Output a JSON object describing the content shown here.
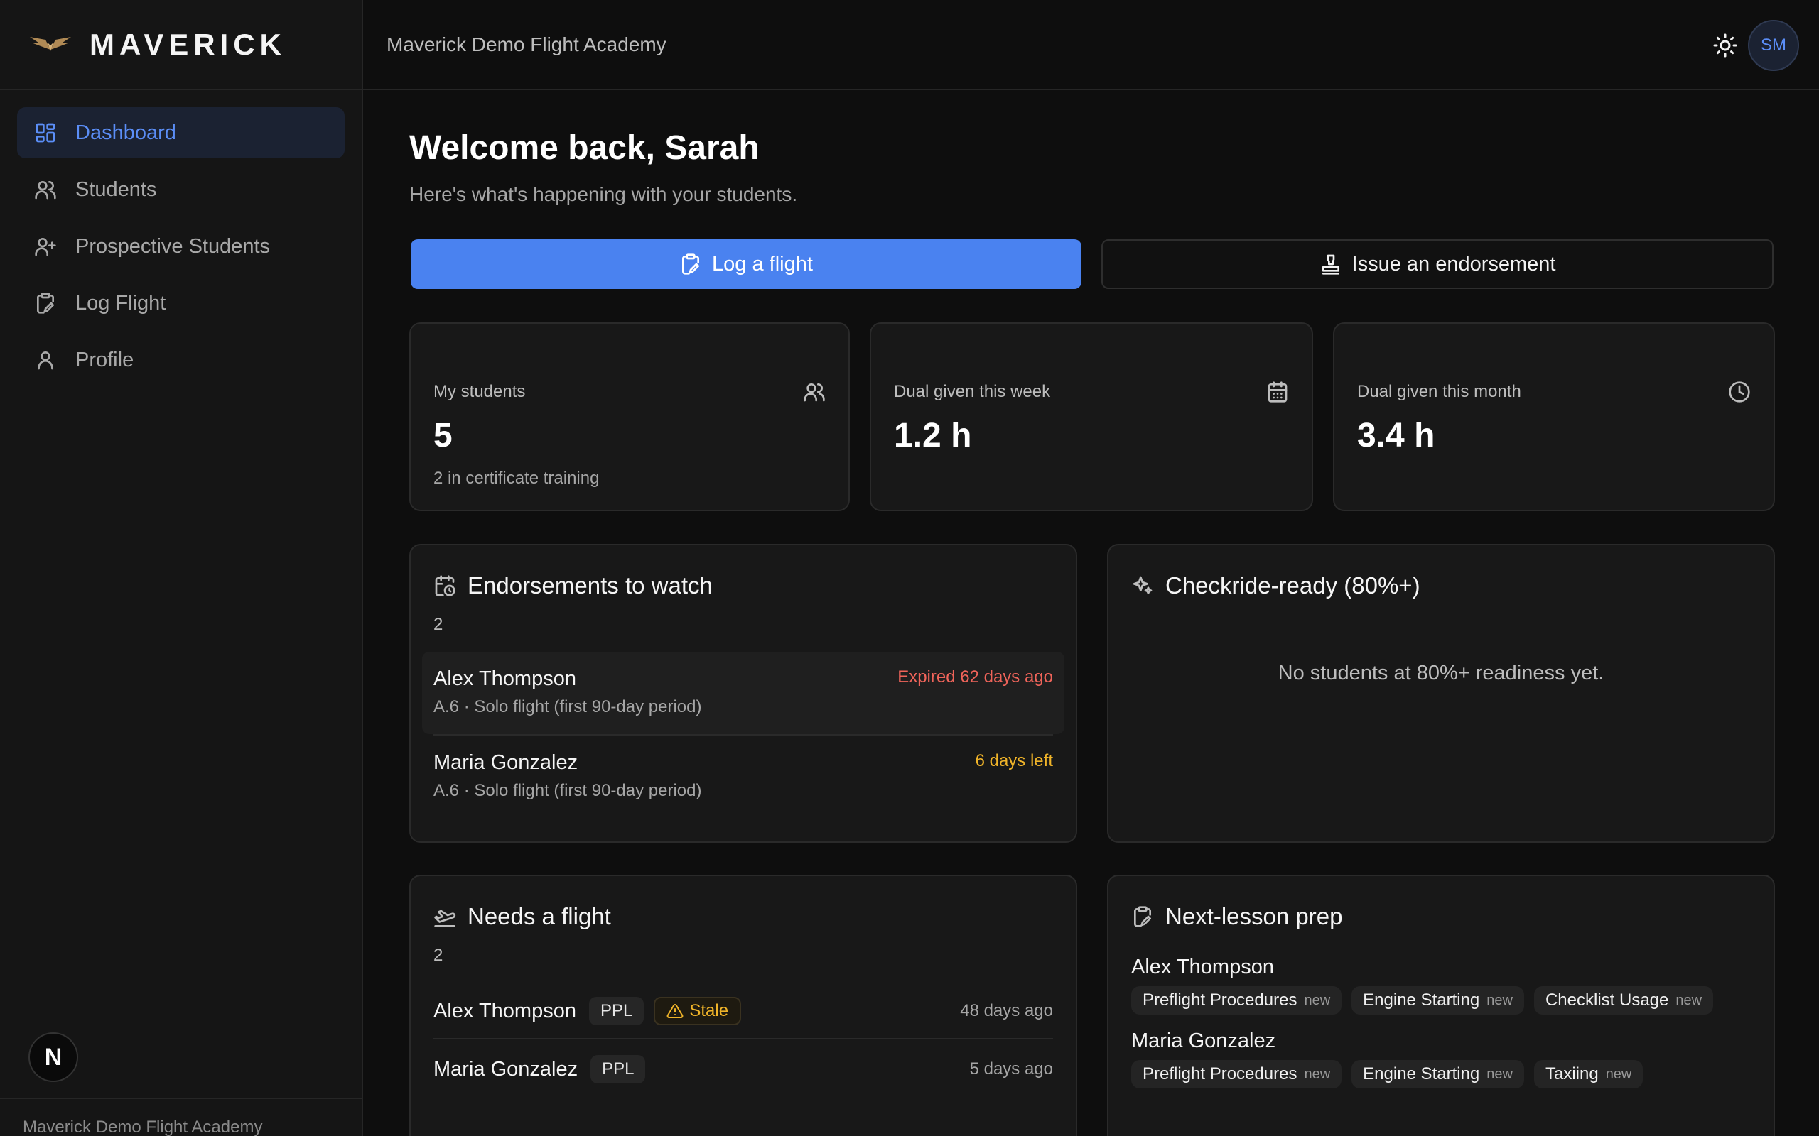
{
  "brand": {
    "name": "MAVERICK"
  },
  "sidebar": {
    "items": [
      {
        "label": "Dashboard",
        "icon": "dashboard-icon",
        "active": true
      },
      {
        "label": "Students",
        "icon": "users-icon"
      },
      {
        "label": "Prospective Students",
        "icon": "user-plus-icon"
      },
      {
        "label": "Log Flight",
        "icon": "clipboard-pen-icon"
      },
      {
        "label": "Profile",
        "icon": "user-icon"
      }
    ],
    "footer": "Maverick Demo Flight Academy",
    "badge": "N"
  },
  "header": {
    "org": "Maverick Demo Flight Academy",
    "avatar": "SM"
  },
  "main": {
    "welcome": "Welcome back, Sarah",
    "subtitle": "Here's what's happening with your students.",
    "actions": {
      "log_flight": "Log a flight",
      "endorsement": "Issue an endorsement"
    },
    "stats": [
      {
        "label": "My students",
        "value": "5",
        "sub": "2 in certificate training"
      },
      {
        "label": "Dual given this week",
        "value": "1.2 h"
      },
      {
        "label": "Dual given this month",
        "value": "3.4 h"
      }
    ],
    "endorsements": {
      "title": "Endorsements to watch",
      "count": "2",
      "items": [
        {
          "name": "Alex Thompson",
          "desc": "A.6 · Solo flight (first 90-day period)",
          "status": "Expired 62 days ago"
        },
        {
          "name": "Maria Gonzalez",
          "desc": "A.6 · Solo flight (first 90-day period)",
          "status": "6 days left"
        }
      ]
    },
    "checkride": {
      "title": "Checkride-ready (80%+)",
      "empty": "No students at 80%+ readiness yet."
    },
    "needs_flight": {
      "title": "Needs a flight",
      "count": "2",
      "items": [
        {
          "name": "Alex Thompson",
          "cert": "PPL",
          "flag": "Stale",
          "ago": "48 days ago"
        },
        {
          "name": "Maria Gonzalez",
          "cert": "PPL",
          "ago": "5 days ago"
        }
      ]
    },
    "prep": {
      "title": "Next-lesson prep",
      "students": [
        {
          "name": "Alex Thompson",
          "tags": [
            {
              "label": "Preflight Procedures",
              "badge": "new"
            },
            {
              "label": "Engine Starting",
              "badge": "new"
            },
            {
              "label": "Checklist Usage",
              "badge": "new"
            }
          ]
        },
        {
          "name": "Maria Gonzalez",
          "tags": [
            {
              "label": "Preflight Procedures",
              "badge": "new"
            },
            {
              "label": "Engine Starting",
              "badge": "new"
            },
            {
              "label": "Taxiing",
              "badge": "new"
            }
          ]
        }
      ]
    }
  },
  "colors": {
    "accent": "#4a82f0",
    "danger": "#f0645a",
    "warning": "#f0b429",
    "bg": "#0e0e0e",
    "card": "#181818"
  }
}
